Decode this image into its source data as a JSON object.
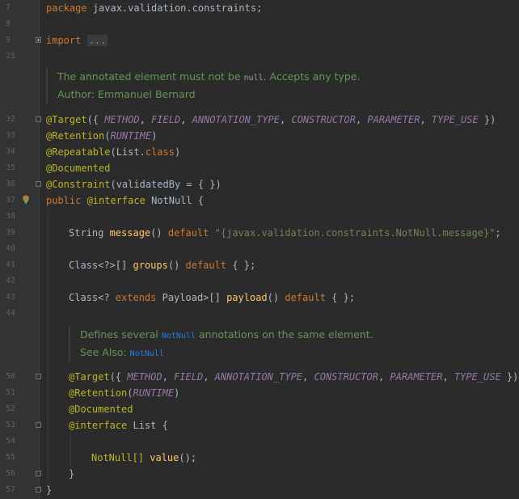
{
  "gutter": {
    "line_numbers": [
      "7",
      "8",
      "9",
      "25",
      "32",
      "33",
      "34",
      "35",
      "36",
      "37",
      "38",
      "39",
      "40",
      "41",
      "42",
      "43",
      "44",
      "50",
      "51",
      "52",
      "53",
      "54",
      "55",
      "56",
      "57"
    ]
  },
  "code": {
    "package_kw": "package",
    "package_name": " javax.validation.constraints;",
    "import_kw": "import",
    "import_folded": "...",
    "doc1": {
      "text_before": "The annotated element must not be ",
      "text_code": "null",
      "text_after": ". Accepts any type.",
      "author": "Author: Emmanuel Bernard"
    },
    "line32": {
      "ann": "@Target",
      "open": "({ ",
      "c1": "METHOD",
      "c2": "FIELD",
      "c3": "ANNOTATION_TYPE",
      "c4": "CONSTRUCTOR",
      "c5": "PARAMETER",
      "c6": "TYPE_USE",
      "sep": ", ",
      "close": " })"
    },
    "line33": {
      "ann": "@Retention",
      "open": "(",
      "c": "RUNTIME",
      "close": ")"
    },
    "line34": {
      "ann": "@Repeatable",
      "open": "(List.",
      "kw": "class",
      "close": ")"
    },
    "line35": {
      "ann": "@Documented"
    },
    "line36": {
      "ann": "@Constraint",
      "rest": "(validatedBy = { })"
    },
    "line37": {
      "kw": "public ",
      "ann": "@interface ",
      "name": "NotNull",
      "rest": " {"
    },
    "line39": {
      "type": "String ",
      "fn": "message",
      "paren": "() ",
      "kw": "default ",
      "str": "\"{javax.validation.constraints.NotNull.message}\"",
      "end": ";"
    },
    "line41": {
      "type": "Class<?>[] ",
      "fn": "groups",
      "paren": "() ",
      "kw": "default ",
      "end": "{ };"
    },
    "line43": {
      "type": "Class<? ",
      "kw1": "extends ",
      "type2": "Payload>[] ",
      "fn": "payload",
      "paren": "() ",
      "kw": "default ",
      "end": "{ };"
    },
    "doc2": {
      "text_before": "Defines several ",
      "text_link": "NotNull",
      "text_after": " annotations on the same element.",
      "see_also": "See Also: ",
      "see_link": "NotNull"
    },
    "line50": {
      "ann": "@Target",
      "open": "({ ",
      "c1": "METHOD",
      "c2": "FIELD",
      "c3": "ANNOTATION_TYPE",
      "c4": "CONSTRUCTOR",
      "c5": "PARAMETER",
      "c6": "TYPE_USE",
      "sep": ", ",
      "close": " })"
    },
    "line51": {
      "ann": "@Retention",
      "open": "(",
      "c": "RUNTIME",
      "close": ")"
    },
    "line52": {
      "ann": "@Documented"
    },
    "line53": {
      "ann": "@interface ",
      "name": "List",
      "rest": " {"
    },
    "line55": {
      "type": "NotNull[] ",
      "fn": "value",
      "end": "();"
    },
    "line56": {
      "text": "}"
    },
    "line57": {
      "text": "}"
    }
  },
  "icons": {
    "line37_gutter": "spring-bean-icon"
  },
  "colors": {
    "background": "#2b2b2b",
    "keyword": "#cc7832",
    "annotation": "#bbb529",
    "constant": "#9876aa",
    "method": "#ffc66d",
    "string": "#6a8759",
    "doc": "#629755"
  }
}
